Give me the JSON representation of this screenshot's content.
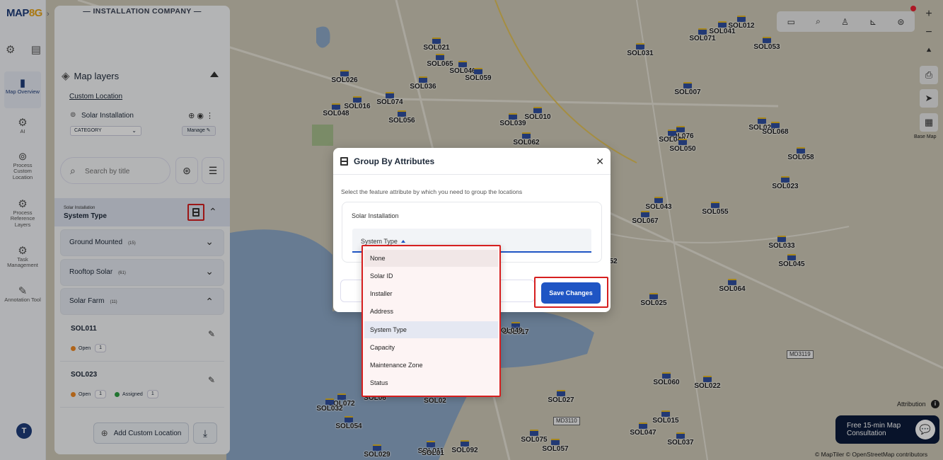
{
  "brand": {
    "logo_part1": "MAP",
    "logo_part2": "8G"
  },
  "nav": {
    "items": [
      {
        "label": "Map Overview",
        "icon": "map-icon"
      },
      {
        "label": "AI",
        "icon": "gear-icon"
      },
      {
        "label": "Process Custom Location",
        "icon": "location-pin-icon"
      },
      {
        "label": "Process Reference Layers",
        "icon": "gear-icon"
      },
      {
        "label": "Task Management",
        "icon": "gear-icon"
      },
      {
        "label": "Annotation Tool",
        "icon": "annotation-icon"
      }
    ],
    "user_initial": "T"
  },
  "panel": {
    "company": "— INSTALLATION COMPANY —",
    "map_layers_title": "Map layers",
    "custom_location_tab": "Custom Location",
    "layer_name": "Solar Installation",
    "category_label": "CATEGORY",
    "manage_label": "Manage ✎",
    "search_placeholder": "Search by title",
    "group_header": {
      "sub": "Solar Installation",
      "main": "System Type"
    },
    "groups": [
      {
        "name": "Ground Mounted",
        "count": "(15)"
      },
      {
        "name": "Rooftop Solar",
        "count": "(61)"
      },
      {
        "name": "Solar Farm",
        "count": "(11)"
      }
    ],
    "cards": [
      {
        "id": "SOL011",
        "statuses": [
          {
            "label": "Open",
            "count": "1",
            "color": "#f08a24"
          }
        ]
      },
      {
        "id": "SOL023",
        "statuses": [
          {
            "label": "Open",
            "count": "1",
            "color": "#f08a24"
          },
          {
            "label": "Assigned",
            "count": "1",
            "color": "#2ea043"
          }
        ]
      }
    ],
    "add_custom_location_label": "Add Custom Location"
  },
  "modal": {
    "title": "Group By Attributes",
    "instruction": "Select the feature attribute by which you need to group the locations",
    "layer_label": "Solar Installation",
    "selected_value": "System Type",
    "save_label": "Save Changes",
    "options": [
      "None",
      "Solar ID",
      "Installer",
      "Address",
      "System Type",
      "Capacity",
      "Maintenance Zone",
      "Status"
    ],
    "selected_option": "System Type"
  },
  "map": {
    "markers": [
      "SOL021",
      "SOL065",
      "SOL046",
      "SOL059",
      "SOL026",
      "SOL036",
      "SOL016",
      "SOL074",
      "SOL048",
      "SOL056",
      "SOL039",
      "SOL010",
      "SOL062",
      "SOL041",
      "SOL012",
      "SOL071",
      "SOL053",
      "SOL031",
      "SOL007",
      "SOL076",
      "SOL049",
      "SOL050",
      "SOL028",
      "SOL068",
      "SOL058",
      "SOL023",
      "SOL043",
      "SOL055",
      "SOL067",
      "SOL033",
      "SOL045",
      "SOL064",
      "SOL025",
      "SOL017",
      "SOL060",
      "SOL022",
      "SOL027",
      "SOL015",
      "SOL047",
      "SOL037",
      "SOL075",
      "SOL057",
      "SOL072",
      "SOL032",
      "SOL054",
      "SOL011",
      "SOL092",
      "SOL029"
    ],
    "road_labels": [
      "MD3119",
      "MD3110"
    ],
    "fragments": [
      "52",
      "SOL06",
      "SOL01",
      "SOL02",
      "SOL049"
    ],
    "base_map_label": "Base Map",
    "attribution": "Attribution",
    "consult_label": "Free 15-min Map Consultation",
    "credit": "© MapTiler © OpenStreetMap contributors"
  },
  "colors": {
    "accent": "#1f55c4",
    "highlight": "#d61f1f",
    "brand": "#1f3d7a"
  }
}
